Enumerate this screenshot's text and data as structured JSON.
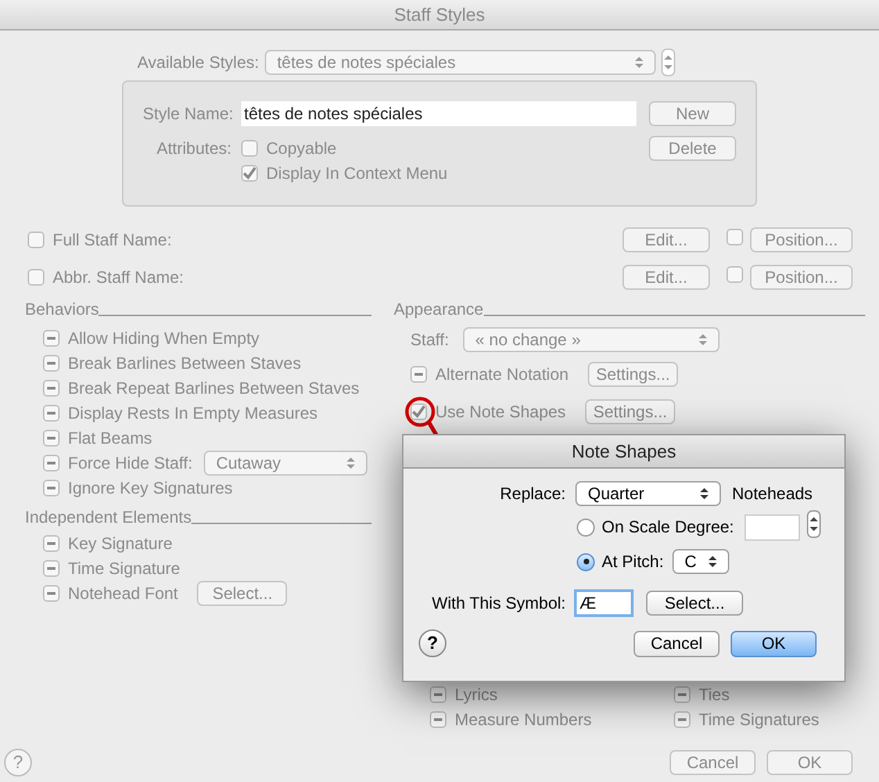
{
  "window": {
    "title": "Staff Styles"
  },
  "available_styles": {
    "label": "Available Styles:",
    "value": "têtes de notes spéciales"
  },
  "style_name": {
    "label": "Style Name:",
    "value": "têtes de notes spéciales",
    "button": "New"
  },
  "attributes": {
    "label": "Attributes:",
    "button": "Delete",
    "options": [
      {
        "label": "Copyable",
        "checked": false
      },
      {
        "label": "Display In Context Menu",
        "checked": true
      }
    ]
  },
  "name_rows": [
    {
      "label": "Full Staff Name:",
      "checked": false,
      "edit": "Edit...",
      "position_checked": false,
      "position": "Position..."
    },
    {
      "label": "Abbr. Staff Name:",
      "checked": false,
      "edit": "Edit...",
      "position_checked": false,
      "position": "Position..."
    }
  ],
  "behaviors": {
    "title": "Behaviors",
    "items": [
      {
        "kind": "mixed",
        "checked": true,
        "label": "Allow Hiding When Empty"
      },
      {
        "kind": "mixed",
        "checked": true,
        "label": "Break Barlines Between Staves"
      },
      {
        "kind": "mixed",
        "checked": true,
        "label": "Break Repeat Barlines Between Staves"
      },
      {
        "kind": "mixed",
        "checked": true,
        "label": "Display Rests In Empty Measures"
      },
      {
        "kind": "mixed",
        "checked": true,
        "label": "Flat Beams"
      },
      {
        "kind": "mixed",
        "checked": true,
        "label": "Force Hide Staff:",
        "select": "Cutaway"
      },
      {
        "kind": "mixed",
        "checked": true,
        "label": "Ignore Key Signatures"
      }
    ]
  },
  "independent_elements": {
    "title": "Independent Elements",
    "items": [
      {
        "kind": "mixed",
        "checked": true,
        "label": "Key Signature"
      },
      {
        "kind": "mixed",
        "checked": true,
        "label": "Time Signature"
      },
      {
        "kind": "mixed",
        "checked": true,
        "label": "Notehead Font",
        "button": "Select..."
      }
    ]
  },
  "appearance": {
    "title": "Appearance",
    "staff": {
      "label": "Staff:",
      "value": "« no change »"
    },
    "items": [
      {
        "kind": "mixed",
        "checked": true,
        "label": "Alternate Notation",
        "button": "Settings..."
      },
      {
        "kind": "checked",
        "checked": true,
        "label": "Use Note Shapes",
        "button": "Settings..."
      }
    ],
    "column_1": [
      {
        "kind": "mixed",
        "checked": true,
        "label": "Lyrics"
      },
      {
        "kind": "mixed",
        "checked": true,
        "label": "Measure Numbers"
      }
    ],
    "column_2": [
      {
        "kind": "mixed",
        "checked": true,
        "label": "Ties"
      },
      {
        "kind": "mixed",
        "checked": true,
        "label": "Time Signatures"
      }
    ]
  },
  "footer": {
    "help": "?",
    "buttons": [
      {
        "label": "Cancel",
        "default": false
      },
      {
        "label": "OK",
        "default": false
      }
    ]
  },
  "note_shapes": {
    "title": "Note Shapes",
    "replace": {
      "label": "Replace:",
      "value": "Quarter",
      "suffix": "Noteheads"
    },
    "options": [
      {
        "label": "On Scale Degree:",
        "selected": false,
        "kind": "field"
      },
      {
        "label": "At Pitch:",
        "selected": true,
        "kind": "select",
        "value": "C"
      }
    ],
    "symbol": {
      "label": "With This Symbol:",
      "value": "Æ",
      "button": "Select..."
    },
    "help": "?",
    "buttons": [
      {
        "label": "Cancel",
        "default": false
      },
      {
        "label": "OK",
        "default": true
      }
    ]
  }
}
